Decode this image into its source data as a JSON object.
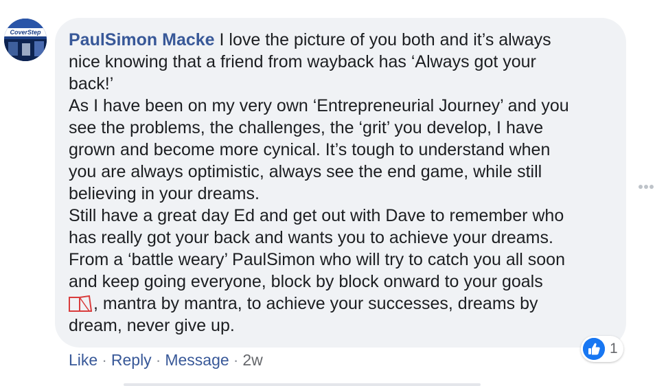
{
  "comment": {
    "author": "PaulSimon Macke",
    "avatar_text": "CoverStep",
    "lines": [
      "I love the picture of you both and it’s always",
      "nice knowing that a friend from wayback has ‘Always got your",
      "back!’",
      "As I have been on my very own ‘Entrepreneurial Journey’ and you",
      "see the problems, the challenges, the ‘grit’ you develop, I have",
      "grown and become more cynical. It’s tough to understand when",
      "you are always optimistic, always see the end game, while still",
      "believing in your dreams.",
      "Still have a great day Ed and get out with Dave to remember who",
      "has really got your back and wants you to achieve your dreams.",
      "From a ‘battle weary’ PaulSimon who will try to catch you all soon",
      "and keep going everyone, block by block onward to your goals",
      ", mantra by mantra, to achieve your successes, dreams by",
      "dream, never give up."
    ],
    "emoji_icon": "bricks-emoji-icon"
  },
  "reactions": {
    "icon": "like-thumb-icon",
    "count": "1",
    "color": "#1877f2"
  },
  "actions": {
    "like": "Like",
    "reply": "Reply",
    "message": "Message",
    "separator": "·",
    "timestamp": "2w"
  },
  "more_options": {
    "icon": "more-horizontal-icon"
  },
  "colors": {
    "bubble": "#f0f2f5",
    "link": "#385898",
    "text": "#1c1e21",
    "muted": "#65676b"
  }
}
